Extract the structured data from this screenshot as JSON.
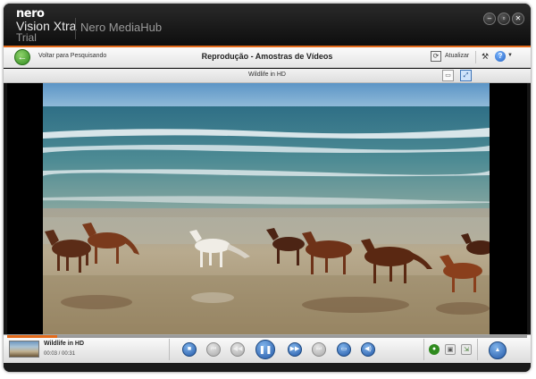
{
  "app": {
    "logo_brand": "nero",
    "logo_product": "Vision Xtra",
    "logo_edition": "Trial",
    "app_name": "Nero MediaHub"
  },
  "window_controls": {
    "minimize_icon": "minimize-icon",
    "maximize_icon": "maximize-icon",
    "close_icon": "close-icon"
  },
  "toolbar": {
    "back_label": "Voltar para Pesquisando",
    "page_title": "Reprodução - Amostras de Vídeos",
    "refresh_label": "Atualizar",
    "help_glyph": "?"
  },
  "subheader": {
    "video_title": "Wildlife in HD"
  },
  "player": {
    "now_playing_title": "Wildlife in HD",
    "time": "00:03 / 00:31",
    "progress": 0.097
  },
  "colors": {
    "accent": "#e36a1a",
    "control_blue": "#2459a8",
    "title_bar": "#141414"
  }
}
